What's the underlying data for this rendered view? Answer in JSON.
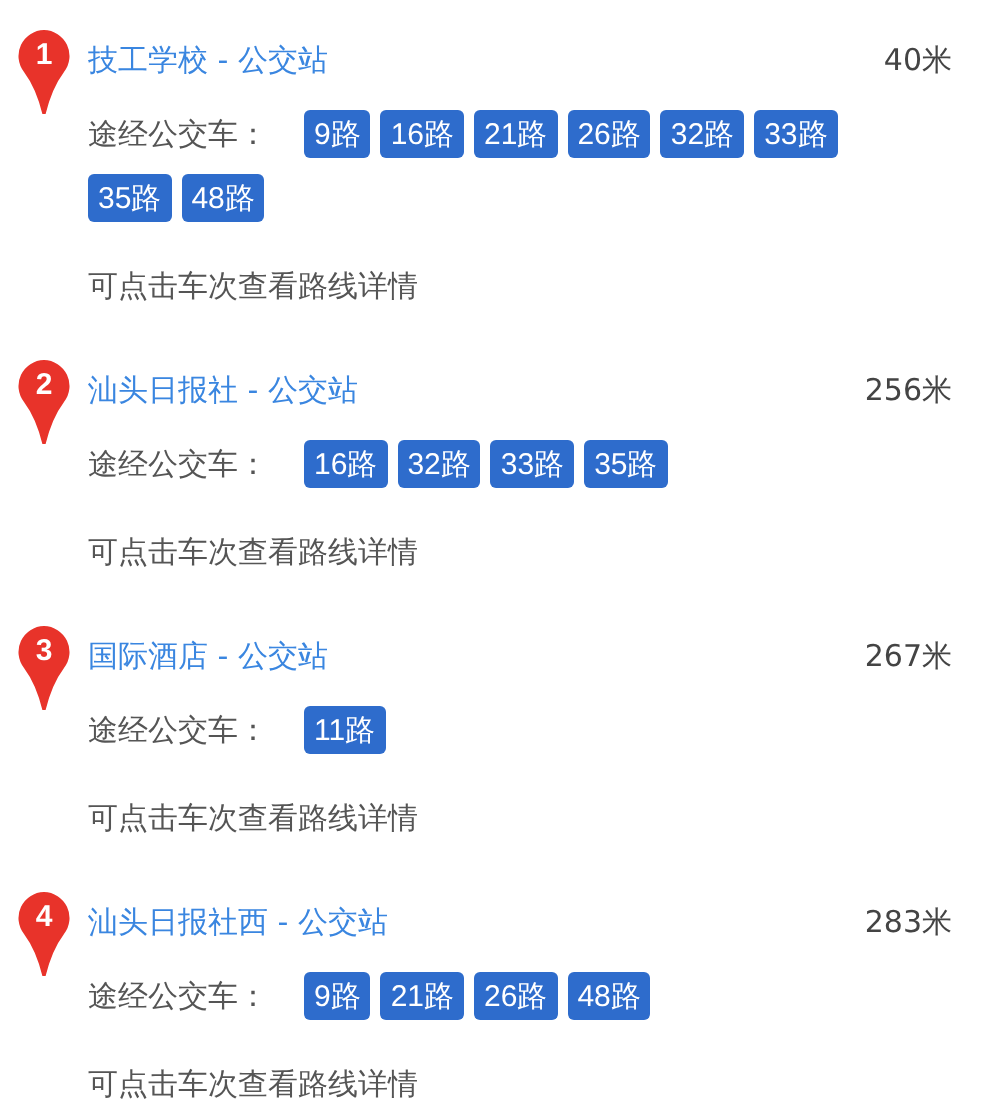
{
  "stops": [
    {
      "number": "1",
      "name": "技工学校 - 公交站",
      "distance": "40米",
      "routes_label": "途经公交车：",
      "routes": [
        "9路",
        "16路",
        "21路",
        "26路",
        "32路",
        "33路",
        "35路",
        "48路"
      ],
      "note": "可点击车次查看路线详情"
    },
    {
      "number": "2",
      "name": "汕头日报社 - 公交站",
      "distance": "256米",
      "routes_label": "途经公交车：",
      "routes": [
        "16路",
        "32路",
        "33路",
        "35路"
      ],
      "note": "可点击车次查看路线详情"
    },
    {
      "number": "3",
      "name": "国际酒店 - 公交站",
      "distance": "267米",
      "routes_label": "途经公交车：",
      "routes": [
        "11路"
      ],
      "note": "可点击车次查看路线详情"
    },
    {
      "number": "4",
      "name": "汕头日报社西 - 公交站",
      "distance": "283米",
      "routes_label": "途经公交车：",
      "routes": [
        "9路",
        "21路",
        "26路",
        "48路"
      ],
      "note": "可点击车次查看路线详情"
    }
  ]
}
